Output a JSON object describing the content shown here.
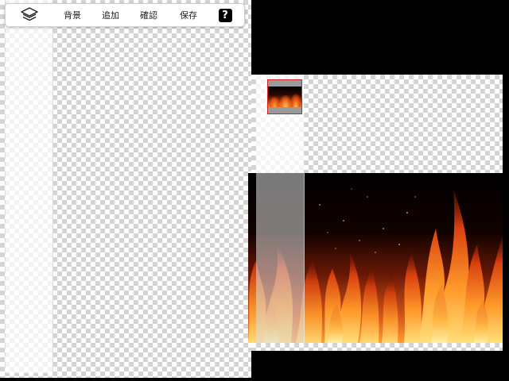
{
  "toolbar": {
    "layers_icon": "layers-icon",
    "background_label": "背景",
    "add_label": "追加",
    "confirm_label": "確認",
    "save_label": "保存",
    "help_label": "?"
  },
  "preview": {
    "layer_thumbnail": "fire-thumbnail",
    "image": "fire-image"
  },
  "colors": {
    "checker_light": "#ffffff",
    "checker_dark": "#d4d4d4",
    "outer_background": "#000000",
    "thumb_border": "#d32020"
  }
}
